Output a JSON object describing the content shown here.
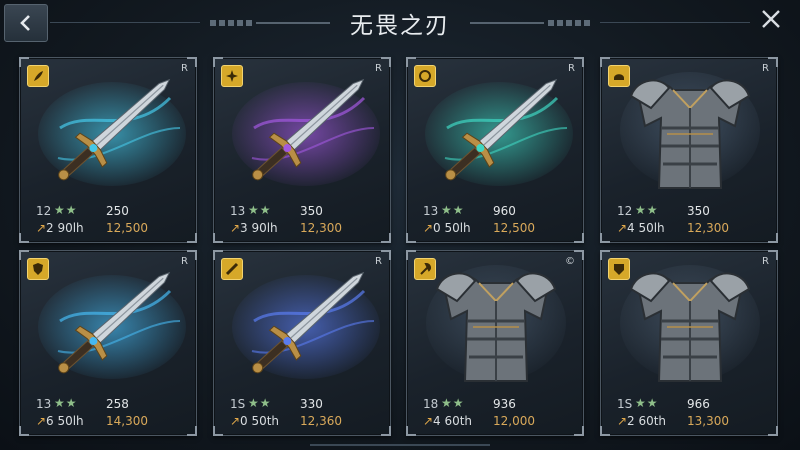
{
  "header": {
    "title": "无畏之刃",
    "back_icon": "chevron-left-icon",
    "close_icon": "close-icon"
  },
  "items": [
    {
      "kind": "sword",
      "glow": "#46c8e8",
      "badge_icon": "feather-icon",
      "mark": "R",
      "level": "12",
      "stars": "★★",
      "value1": "250",
      "arrow": "↗",
      "upgrade": "2 90lh",
      "value2": "12,500"
    },
    {
      "kind": "sword",
      "glow": "#a259e0",
      "badge_icon": "star-burst-icon",
      "mark": "R",
      "level": "13",
      "stars": "★★",
      "value1": "350",
      "arrow": "↗",
      "upgrade": "3 90lh",
      "value2": "12,300"
    },
    {
      "kind": "sword",
      "glow": "#3fd6c2",
      "badge_icon": "ring-icon",
      "mark": "R",
      "level": "13",
      "stars": "★★",
      "value1": "960",
      "arrow": "↗",
      "upgrade": "0 50lh",
      "value2": "12,500"
    },
    {
      "kind": "armor",
      "glow": "#5a6f86",
      "badge_icon": "helmet-icon",
      "mark": "R",
      "level": "12",
      "stars": "★★",
      "value1": "350",
      "arrow": "↗",
      "upgrade": "4 50lh",
      "value2": "12,300"
    },
    {
      "kind": "sword",
      "glow": "#46b8f0",
      "badge_icon": "shield-emblem-icon",
      "mark": "R",
      "level": "13",
      "stars": "★★",
      "value1": "258",
      "arrow": "↗",
      "upgrade": "6 50lh",
      "value2": "14,300"
    },
    {
      "kind": "sword",
      "glow": "#5a7cf0",
      "badge_icon": "scroll-icon",
      "mark": "R",
      "level": "1S",
      "stars": "★★",
      "value1": "330",
      "arrow": "↗",
      "upgrade": "0 50th",
      "value2": "12,360"
    },
    {
      "kind": "armor",
      "glow": "#52657a",
      "badge_icon": "axe-icon",
      "mark": "©",
      "level": "18",
      "stars": "★★",
      "value1": "936",
      "arrow": "↗",
      "upgrade": "4 60th",
      "value2": "12,000"
    },
    {
      "kind": "armor",
      "glow": "#57697d",
      "badge_icon": "crest-icon",
      "mark": "R",
      "level": "1S",
      "stars": "★★",
      "value1": "966",
      "arrow": "↗",
      "upgrade": "2 60th",
      "value2": "13,300"
    }
  ]
}
